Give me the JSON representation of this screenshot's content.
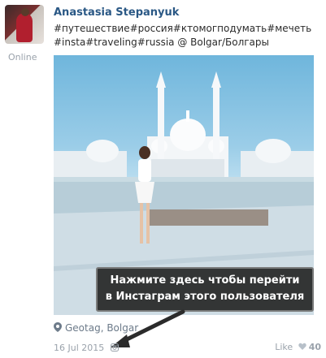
{
  "author": {
    "name": "Anastasia Stepanyuk",
    "status": "Online"
  },
  "post": {
    "caption": "#путешествие#россия#ктомогподумать#мечеть#insta#traveling#russia @ Bolgar/Болгары",
    "tooltip_line1": "Нажмите здесь чтобы перейти",
    "tooltip_line2": "в Инстаграм этого пользователя",
    "geotag": "Geotag, Bolgar",
    "date": "16 Jul 2015",
    "like_label": "Like",
    "like_count": "40"
  },
  "icons": {
    "location": "pin-icon",
    "source": "instagram-icon",
    "like": "heart-icon"
  },
  "colors": {
    "link": "#2a5885",
    "muted": "#9aa2ab",
    "tooltip_bg": "#262626"
  }
}
